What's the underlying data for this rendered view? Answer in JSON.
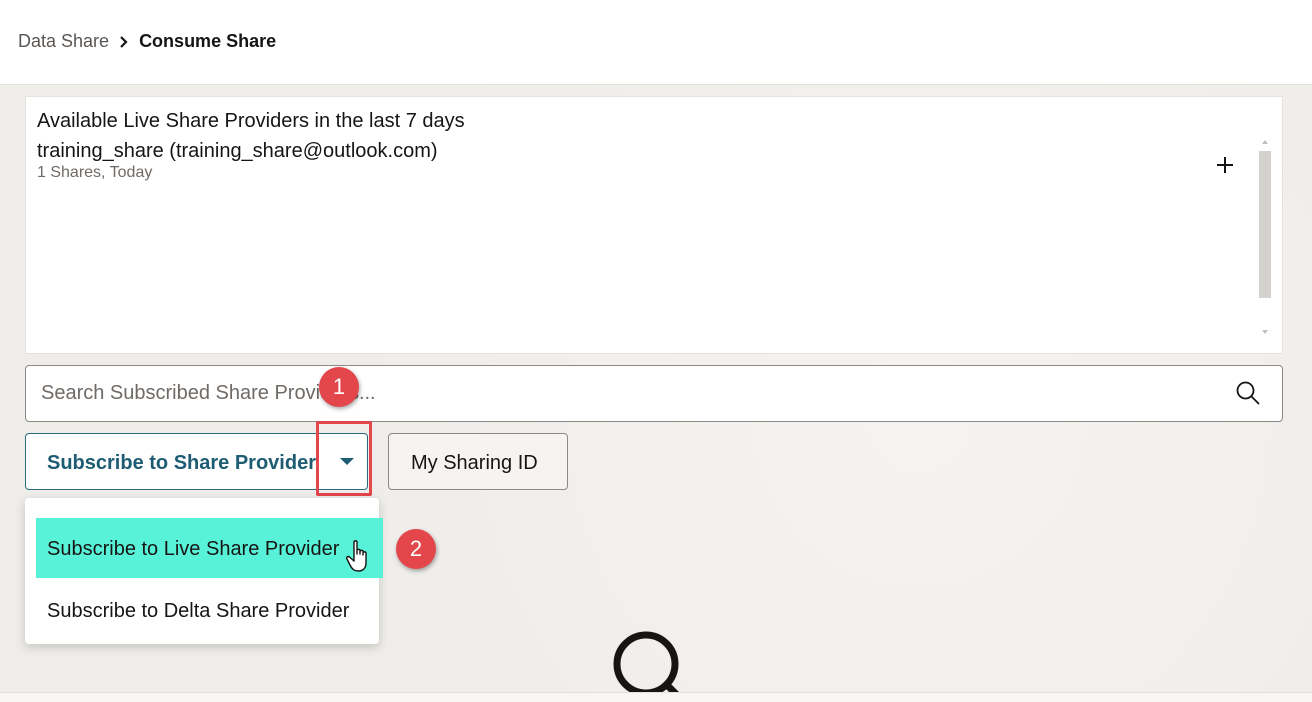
{
  "breadcrumb": {
    "parent": "Data Share",
    "current": "Consume Share"
  },
  "providers_panel": {
    "title": "Available Live Share Providers in the last 7 days",
    "items": [
      {
        "name": "training_share (training_share@outlook.com)",
        "meta": "1 Shares, Today"
      }
    ]
  },
  "search": {
    "placeholder": "Search Subscribed Share Providers..."
  },
  "actions": {
    "subscribe_label": "Subscribe to Share Provider",
    "sharing_id_label": "My Sharing ID"
  },
  "dropdown": {
    "items": [
      {
        "label": "Subscribe to Live Share Provider",
        "state": "highlighted"
      },
      {
        "label": "Subscribe to Delta Share Provider",
        "state": "normal"
      }
    ]
  },
  "annotations": {
    "step1": "1",
    "step2": "2"
  },
  "colors": {
    "accent": "#1d5c72",
    "highlight": "#58f2d8",
    "marker": "#e3464b"
  },
  "icons": [
    "chevron-right-icon",
    "plus-icon",
    "search-icon",
    "caret-down-icon",
    "hand-pointer-icon"
  ]
}
